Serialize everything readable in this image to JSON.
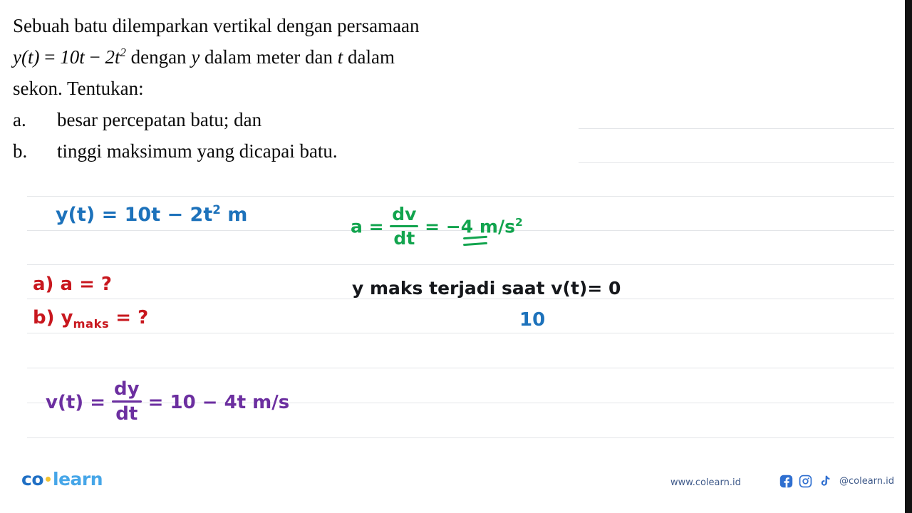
{
  "question": {
    "line1": "Sebuah batu dilemparkan vertikal dengan persamaan",
    "line2_pre": "y(t)",
    "line2_eq": "=",
    "line2_expr_a": "10t",
    "line2_minus": "−",
    "line2_expr_b": "2t",
    "line2_exp": "2",
    "line2_post": " dengan ",
    "line2_var_y": "y",
    "line2_mid": " dalam meter dan ",
    "line2_var_t": "t",
    "line2_end": " dalam",
    "line3": "sekon. Tentukan:",
    "items": [
      {
        "label": "a.",
        "text": "besar percepatan batu; dan"
      },
      {
        "label": "b.",
        "text": "tinggi maksimum yang dicapai batu."
      }
    ]
  },
  "handwriting": {
    "position_equation": {
      "lhs": "y(t) =",
      "rhs": "10t − 2t",
      "exponent": "2",
      "unit": "m"
    },
    "ask_a": "a)  a = ?",
    "ask_b_prefix": "b)  y",
    "ask_b_sub": "maks",
    "ask_b_suffix": "= ?",
    "acceleration": {
      "lead": "a =",
      "frac_num": "dv",
      "frac_den": "dt",
      "equals": "=",
      "value": "−4",
      "unit_m": "m/s",
      "unit_exp": "2"
    },
    "condition_note": "y maks terjadi saat v(t)= 0",
    "blue_ten": "10",
    "velocity": {
      "lhs": "v(t) =",
      "frac_num": "dy",
      "frac_den": "dt",
      "equals": "=",
      "rhs": "10 − 4t  m/s"
    }
  },
  "footer": {
    "logo_co": "co",
    "logo_learn": "learn",
    "url": "www.colearn.id",
    "handle": "@colearn.id",
    "icons": [
      "facebook-icon",
      "instagram-icon",
      "tiktok-icon"
    ]
  },
  "colors": {
    "ink_blue": "#1d72bb",
    "ink_red": "#c8171e",
    "ink_green": "#12a44e",
    "ink_purple": "#6c2fa0",
    "ink_black": "#16181c",
    "rule_line": "#e3e5e8",
    "brand_blue": "#1f6fc4",
    "brand_light_blue": "#46a6e8"
  }
}
